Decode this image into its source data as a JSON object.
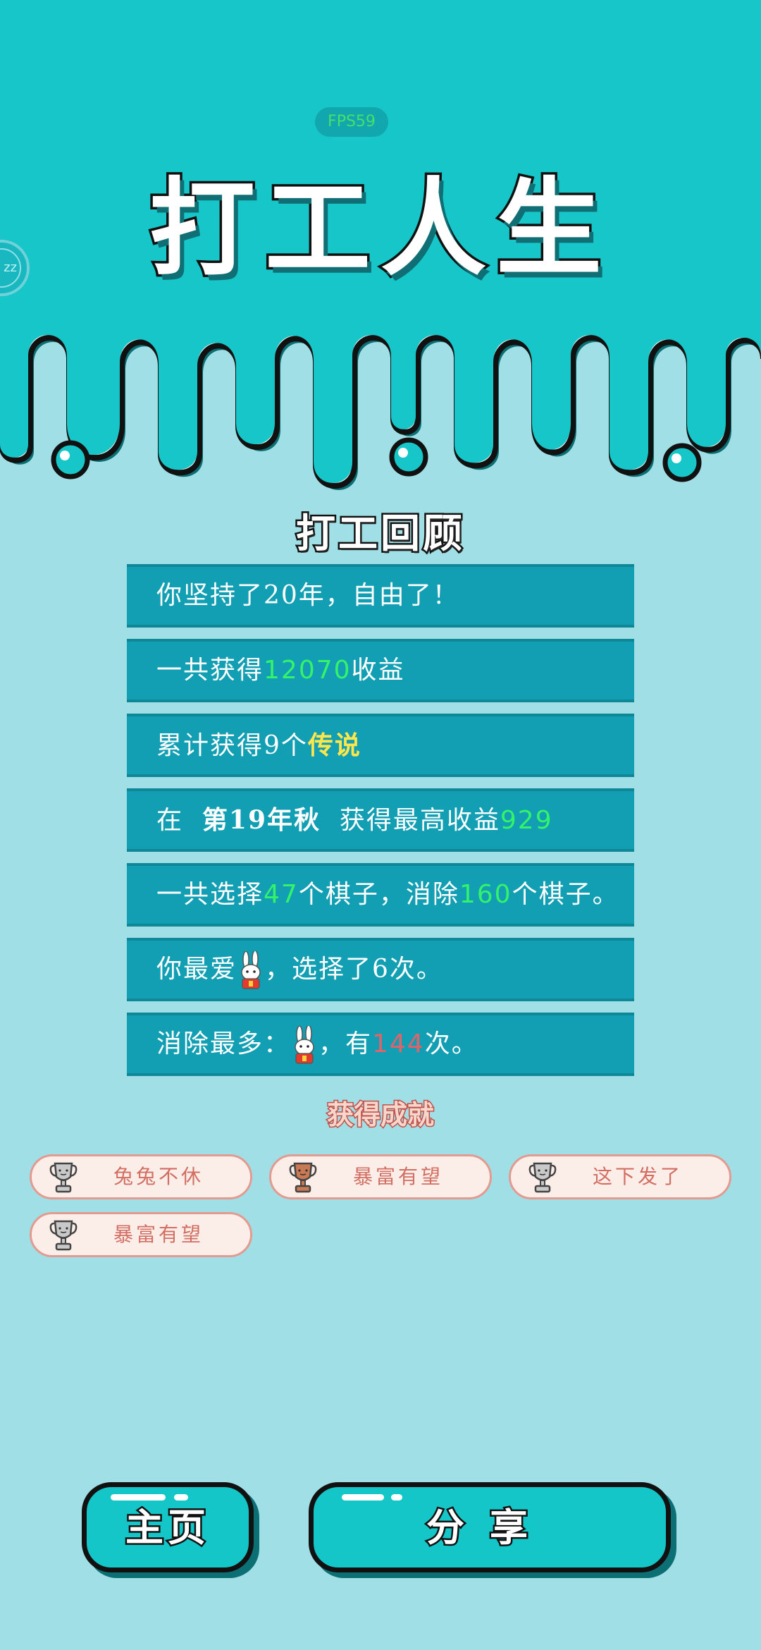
{
  "header": {
    "fps_label": "FPS59",
    "side_badge_text": "zz",
    "game_title": "打工人生"
  },
  "review": {
    "title": "打工回顾",
    "rows": [
      {
        "parts": [
          {
            "text": "你坚持了20年，自由了！",
            "style": "normal"
          }
        ]
      },
      {
        "parts": [
          {
            "text": "一共获得",
            "style": "normal"
          },
          {
            "text": "12070",
            "style": "green"
          },
          {
            "text": "收益",
            "style": "normal"
          }
        ]
      },
      {
        "parts": [
          {
            "text": "累计获得9个",
            "style": "normal"
          },
          {
            "text": "传说",
            "style": "yellow"
          }
        ]
      },
      {
        "parts": [
          {
            "text": "在  ",
            "style": "normal"
          },
          {
            "text": "第19年秋",
            "style": "bold"
          },
          {
            "text": "  获得最高收益",
            "style": "normal"
          },
          {
            "text": "929",
            "style": "green"
          }
        ]
      },
      {
        "parts": [
          {
            "text": "一共选择",
            "style": "normal"
          },
          {
            "text": "47",
            "style": "green"
          },
          {
            "text": "个棋子，消除",
            "style": "normal"
          },
          {
            "text": "160",
            "style": "green"
          },
          {
            "text": "个棋子。",
            "style": "normal"
          }
        ]
      },
      {
        "parts": [
          {
            "text": "你最爱",
            "style": "normal"
          },
          {
            "icon": "bunny-icon"
          },
          {
            "text": "，选择了6次。",
            "style": "normal"
          }
        ]
      },
      {
        "parts": [
          {
            "text": "消除最多：",
            "style": "normal"
          },
          {
            "icon": "bunny-icon"
          },
          {
            "text": "，有",
            "style": "normal"
          },
          {
            "text": "144",
            "style": "red"
          },
          {
            "text": "次。",
            "style": "normal"
          }
        ]
      }
    ]
  },
  "achievements": {
    "title": "获得成就",
    "items": [
      {
        "label": "兔兔不休",
        "trophy": "silver"
      },
      {
        "label": "暴富有望",
        "trophy": "bronze"
      },
      {
        "label": "这下发了",
        "trophy": "silver"
      },
      {
        "label": "暴富有望",
        "trophy": "silver"
      }
    ]
  },
  "buttons": {
    "home_label": "主页",
    "share_label": "分享"
  },
  "colors": {
    "top_band": "#16c6c9",
    "page_background": "#a0dfe5",
    "row_background": "#139fb3",
    "value_green": "#33f36a",
    "legend_yellow": "#ffe64a",
    "count_red": "#e0636a",
    "achievement_text": "#d26e62",
    "trophy_silver": "#c9c9c9",
    "trophy_bronze": "#c87a55"
  }
}
